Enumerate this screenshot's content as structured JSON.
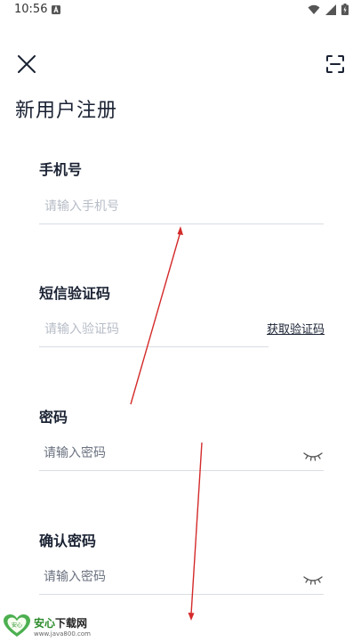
{
  "status_bar": {
    "time": "10:56",
    "notification_icon": "a-notification-icon",
    "icons": [
      "wifi-icon",
      "signal-icon",
      "battery-charging-icon"
    ]
  },
  "toolbar": {
    "close_icon": "close-icon",
    "scan_icon": "scan-icon"
  },
  "page": {
    "title": "新用户注册"
  },
  "form": {
    "phone": {
      "label": "手机号",
      "placeholder": "请输入手机号",
      "value": ""
    },
    "sms_code": {
      "label": "短信验证码",
      "placeholder": "请输入验证码",
      "value": "",
      "get_code_label": "获取验证码"
    },
    "password": {
      "label": "密码",
      "placeholder": "请输入密码",
      "value": "",
      "toggle_icon": "eye-closed-icon"
    },
    "confirm_password": {
      "label": "确认密码",
      "placeholder": "请输入密码",
      "value": "",
      "toggle_icon": "eye-closed-icon"
    }
  },
  "colors": {
    "text_primary": "#1a2233",
    "placeholder": "#b7bdc7",
    "divider": "#d9dde3",
    "annotation_arrow": "#d42a2a"
  },
  "watermark": {
    "brand_a": "安心",
    "brand_b": "下载网",
    "url": "www.java800.com",
    "logo_text": "安心"
  }
}
